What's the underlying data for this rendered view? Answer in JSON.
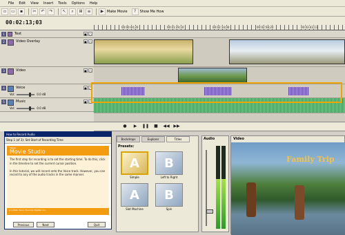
{
  "menu": [
    "File",
    "Edit",
    "View",
    "Insert",
    "Tools",
    "Options",
    "Help"
  ],
  "toolbar": {
    "make_movie": "Make Movie",
    "show_me_how": "Show Me How"
  },
  "timecode": "00:02:13;03",
  "ruler_labels": [
    "00:00:44;20",
    "00:01:29;10",
    "00:02:14;00",
    "00:02:58;20",
    "00:03:43;11",
    "00:04:28;01"
  ],
  "tracks": [
    {
      "num": "1",
      "name": "Text"
    },
    {
      "num": "2",
      "name": "Video Overlay"
    },
    {
      "num": "3",
      "name": "Video"
    },
    {
      "num": "4",
      "name": "Voice",
      "vol_label": "Vol:",
      "db": "0.0 dB"
    },
    {
      "num": "5",
      "name": "Music",
      "vol_label": "Vol:",
      "db": "0.0 dB"
    }
  ],
  "help": {
    "title": "How to Record Audio",
    "step": "Step 1 (of 3):  Set Start of Recording Time",
    "brand_small": "Vegas",
    "brand": "Movie Studio",
    "body": "The first step for recording is to set the starting time. To do this, click in the timeline to set the current cursor position.\n\nIn this tutorial, we will record onto the Voice track. However, you can record to any of the audio tracks in the same manner.",
    "footer": "(c) 2004, Sonic Foundry Digital, Inc.",
    "prev": "Previous",
    "next": "Next",
    "quit": "Quit"
  },
  "fx": {
    "tabs": [
      "Backdrops",
      "Explorer",
      "Titles"
    ],
    "presets_label": "Presets:",
    "presets": [
      {
        "glyph": "A",
        "label": "Simple"
      },
      {
        "glyph": "B",
        "label": "Left to Right"
      },
      {
        "glyph": "A",
        "label": "Slot Machine"
      },
      {
        "glyph": "B",
        "label": "Spin"
      }
    ]
  },
  "audio": {
    "label": "Audio",
    "level_fraction": 0.6
  },
  "video": {
    "label": "Video",
    "overlay_text": "Family Trip"
  },
  "colors": {
    "accent": "#f39c12",
    "selection": "#f0a400",
    "title_bar": "#0a246a"
  }
}
